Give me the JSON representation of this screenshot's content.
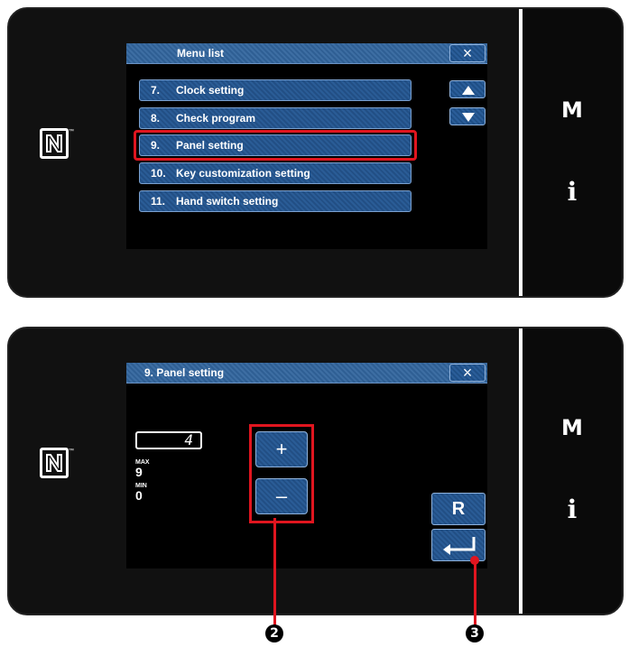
{
  "screen1": {
    "title": "Menu list",
    "close_icon": "×",
    "items": [
      {
        "num": "7.",
        "label": "Clock setting"
      },
      {
        "num": "8.",
        "label": "Check program"
      },
      {
        "num": "9.",
        "label": "Panel setting"
      },
      {
        "num": "10.",
        "label": "Key customization setting"
      },
      {
        "num": "11.",
        "label": "Hand switch setting"
      }
    ],
    "highlighted_item": "9. Panel setting"
  },
  "screen2": {
    "title": "9.   Panel setting",
    "close_icon": "×",
    "value": "4",
    "max_label": "MAX",
    "max_value": "9",
    "min_label": "MIN",
    "min_value": "0",
    "plus_label": "+",
    "minus_label": "–",
    "reset_label": "R"
  },
  "side_panel": {
    "m_label": "M",
    "i_label": "i"
  },
  "nfc": {
    "tm": "™"
  },
  "callouts": {
    "two": "2",
    "three": "3"
  },
  "colors": {
    "highlight": "#e0151f",
    "button_blue": "#2a5c96",
    "background": "#000000"
  }
}
